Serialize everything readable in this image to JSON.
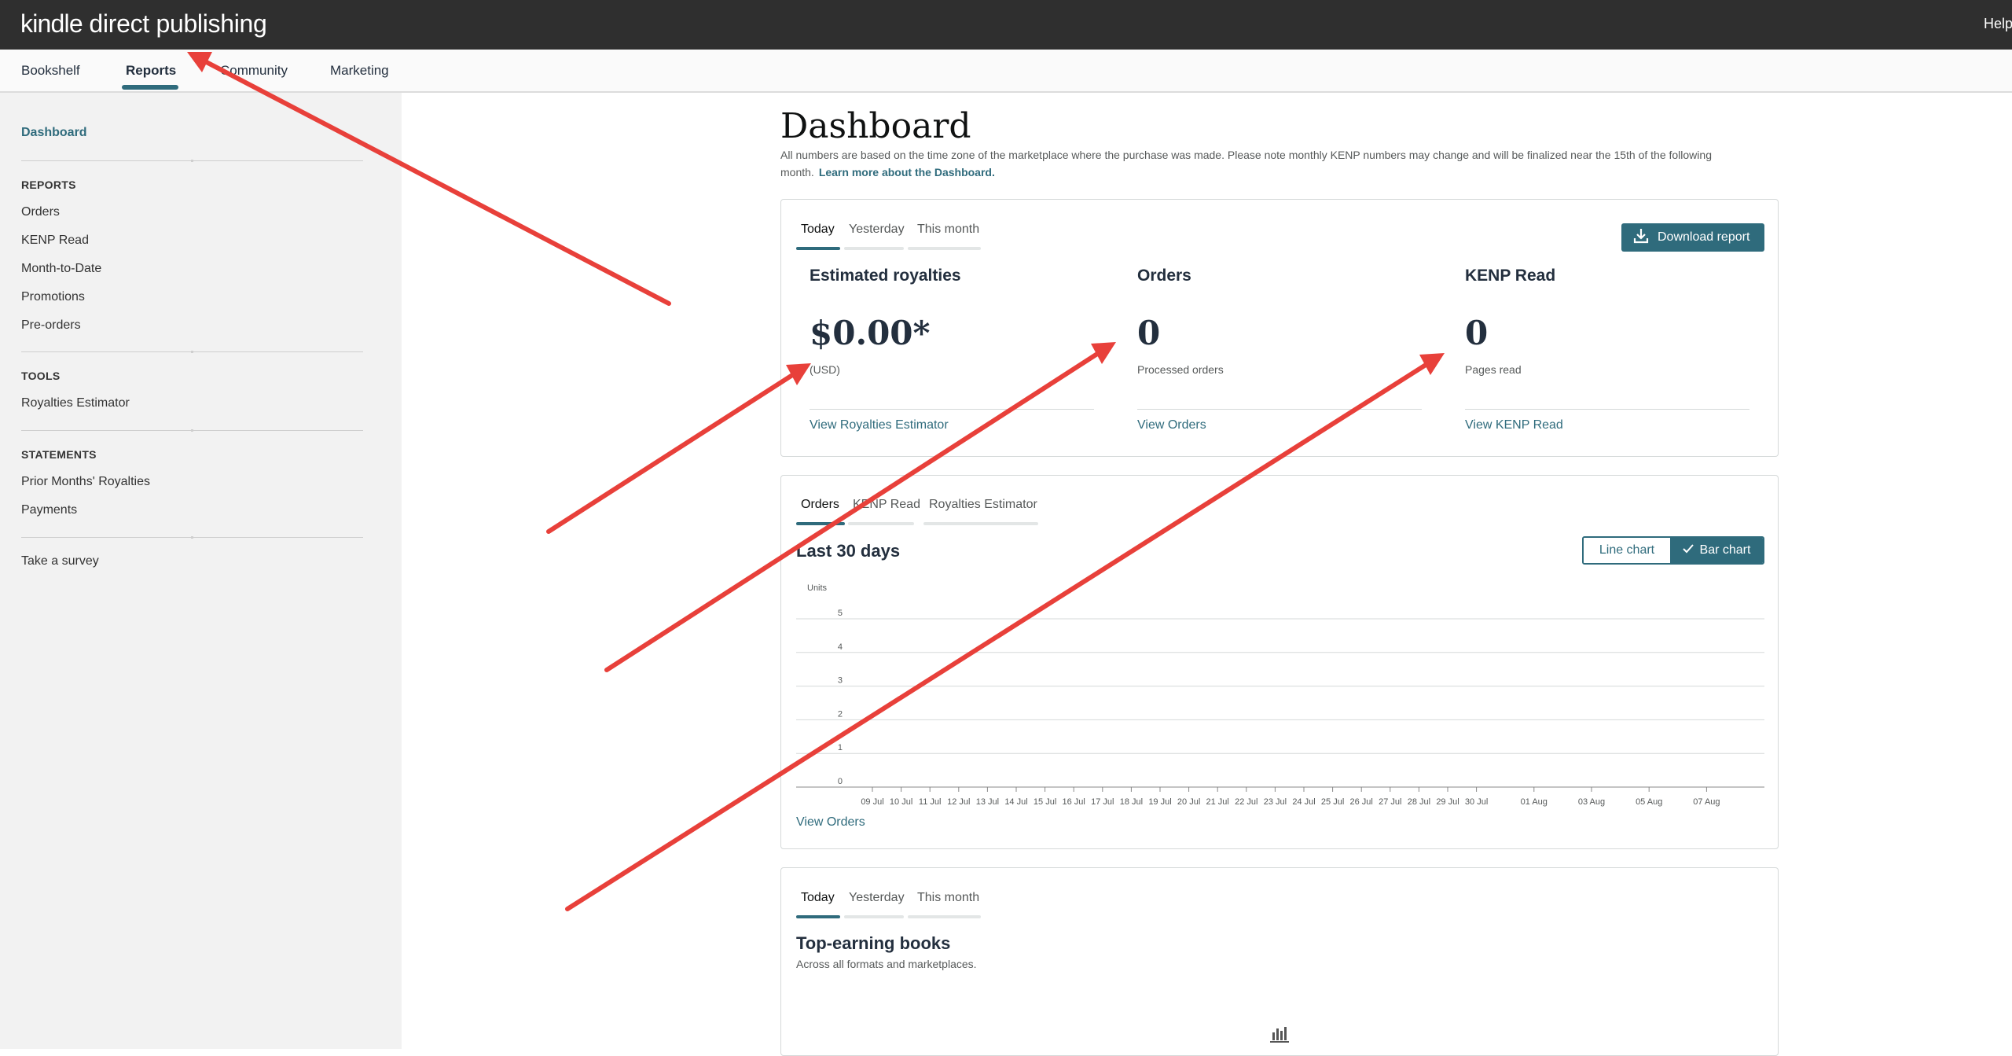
{
  "header": {
    "logo_kindle": "kindle",
    "logo_rest": " direct publishing",
    "help_label": "Help"
  },
  "nav": {
    "tabs": [
      {
        "label": "Bookshelf",
        "active": false
      },
      {
        "label": "Reports",
        "active": true
      },
      {
        "label": "Community",
        "active": false
      },
      {
        "label": "Marketing",
        "active": false
      }
    ]
  },
  "sidebar": {
    "dashboard": "Dashboard",
    "reports_heading": "REPORTS",
    "reports_items": [
      "Orders",
      "KENP Read",
      "Month-to-Date",
      "Promotions",
      "Pre-orders"
    ],
    "tools_heading": "TOOLS",
    "tools_items": [
      "Royalties Estimator"
    ],
    "statements_heading": "STATEMENTS",
    "statements_items": [
      "Prior Months' Royalties",
      "Payments"
    ],
    "survey": "Take a survey"
  },
  "main": {
    "title": "Dashboard",
    "intro": "All numbers are based on the time zone of the marketplace where the purchase was made. Please note monthly KENP numbers may change and will be finalized near the 15th of the following month.",
    "intro_link": "Learn more about the Dashboard."
  },
  "summary_card": {
    "tabs": [
      "Today",
      "Yesterday",
      "This month"
    ],
    "download_label": "Download report",
    "metrics": [
      {
        "label": "Estimated royalties",
        "value": "$0.00*",
        "sub": "(USD)",
        "link": "View Royalties Estimator"
      },
      {
        "label": "Orders",
        "value": "0",
        "sub": "Processed orders",
        "link": "View Orders"
      },
      {
        "label": "KENP Read",
        "value": "0",
        "sub": "Pages read",
        "link": "View KENP Read"
      }
    ]
  },
  "chart_card": {
    "tabs": [
      "Orders",
      "KENP Read",
      "Royalties Estimator"
    ],
    "heading": "Last 30 days",
    "line_chart_label": "Line chart",
    "bar_chart_label": "Bar chart",
    "view_link": "View Orders"
  },
  "chart_data": {
    "type": "bar",
    "ylabel": "Units",
    "xlabel": "",
    "ylim": [
      0,
      5
    ],
    "yticks": [
      0,
      1,
      2,
      3,
      4,
      5
    ],
    "categories": [
      "09 Jul",
      "10 Jul",
      "11 Jul",
      "12 Jul",
      "13 Jul",
      "14 Jul",
      "15 Jul",
      "16 Jul",
      "17 Jul",
      "18 Jul",
      "19 Jul",
      "20 Jul",
      "21 Jul",
      "22 Jul",
      "23 Jul",
      "24 Jul",
      "25 Jul",
      "26 Jul",
      "27 Jul",
      "28 Jul",
      "29 Jul",
      "30 Jul",
      "01 Aug",
      "03 Aug",
      "05 Aug",
      "07 Aug"
    ],
    "values": [
      0,
      0,
      0,
      0,
      0,
      0,
      0,
      0,
      0,
      0,
      0,
      0,
      0,
      0,
      0,
      0,
      0,
      0,
      0,
      0,
      0,
      0,
      0,
      0,
      0,
      0
    ],
    "grid": true
  },
  "top_card": {
    "tabs": [
      "Today",
      "Yesterday",
      "This month"
    ],
    "heading": "Top-earning books",
    "sub": "Across all formats and marketplaces."
  },
  "colors": {
    "header_bg": "#2f2f2f",
    "accent": "#2f6b7c",
    "sidebar_bg": "#f2f2f2",
    "annotation_arrow": "#e8403a"
  },
  "icons": [
    "download-icon",
    "check-icon",
    "bar-chart-icon"
  ]
}
